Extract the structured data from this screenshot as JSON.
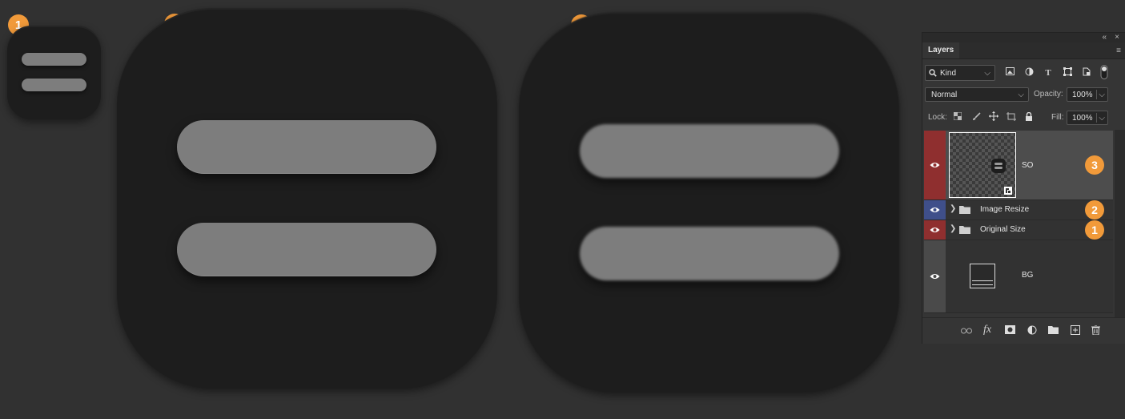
{
  "badges": [
    "1",
    "2",
    "3"
  ],
  "panel": {
    "collapse_icon": "«",
    "close_icon": "×",
    "tab": "Layers",
    "menu_icon": "≡",
    "filter": {
      "search_icon": "search-icon",
      "kind": "Kind",
      "chevron": "⌵"
    },
    "blend_mode": "Normal",
    "opacity_label": "Opacity:",
    "opacity_value": "100%",
    "lock_label": "Lock:",
    "fill_label": "Fill:",
    "fill_value": "100%",
    "layers": [
      {
        "name": "SO",
        "badge": "3",
        "eye_color": "#8f2f2f",
        "selected": true
      },
      {
        "name": "Image Resize",
        "badge": "2",
        "eye_color": "#3f4f8a",
        "group": true
      },
      {
        "name": "Original Size",
        "badge": "1",
        "eye_color": "#8f2f2f",
        "group": true
      },
      {
        "name": "BG",
        "eye_color": "#4a4a4a"
      }
    ],
    "footer_icons": [
      "link-icon",
      "fx-icon",
      "mask-icon",
      "adjustment-icon",
      "folder-icon",
      "new-layer-icon",
      "trash-icon"
    ],
    "fx_label": "fx"
  }
}
